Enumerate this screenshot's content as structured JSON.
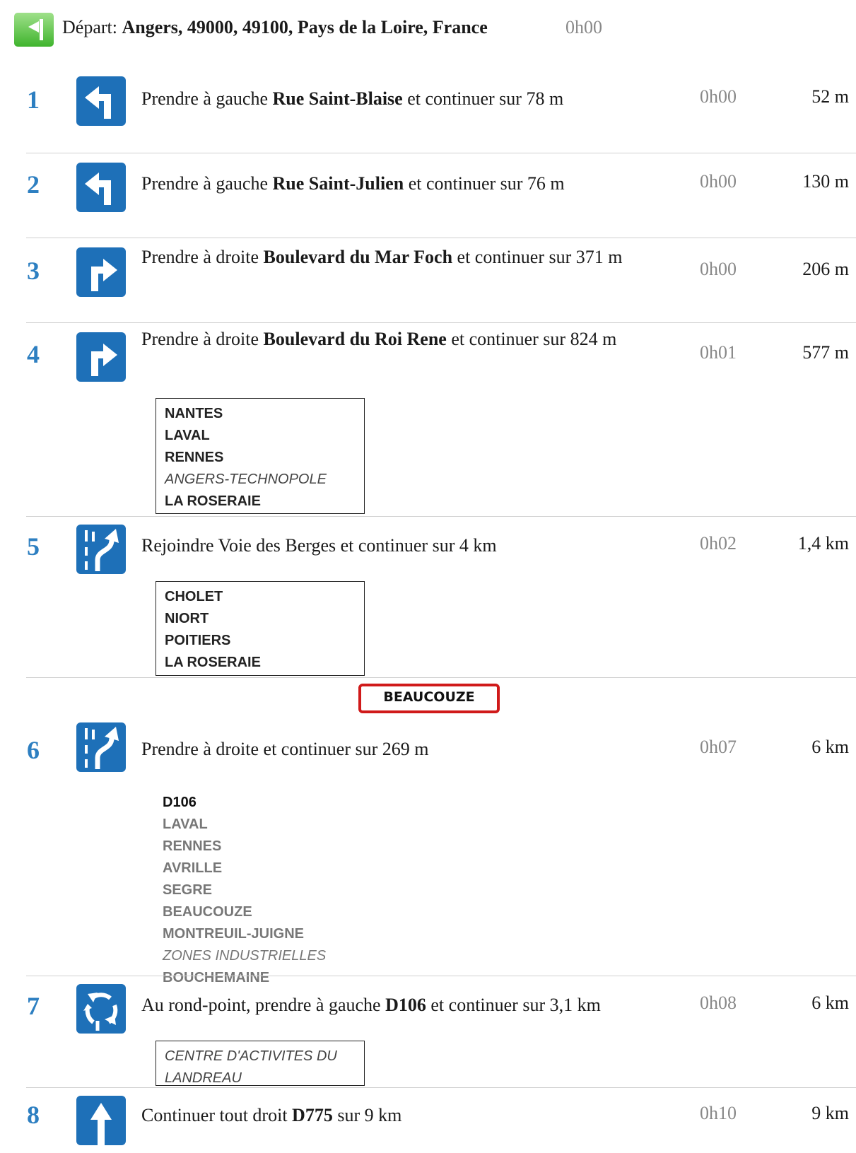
{
  "departure": {
    "prefix": "Départ:",
    "place": "Angers, 49000, 49100, Pays de la Loire, France",
    "time": "0h00",
    "icon": "start-flag-icon"
  },
  "steps": [
    {
      "num": "1",
      "icon": "turn-left-icon",
      "pre": "Prendre à gauche ",
      "road": "Rue Saint-Blaise",
      "post": " et continuer sur 78 m",
      "time": "0h00",
      "dist": "52 m"
    },
    {
      "num": "2",
      "icon": "turn-left-icon",
      "pre": "Prendre à gauche ",
      "road": "Rue Saint-Julien",
      "post": " et continuer sur 76 m",
      "time": "0h00",
      "dist": "130 m"
    },
    {
      "num": "3",
      "icon": "turn-right-icon",
      "pre": "Prendre à droite ",
      "road": "Boulevard du Mar Foch",
      "post": " et continuer sur 371 m",
      "time": "0h00",
      "dist": "206 m"
    },
    {
      "num": "4",
      "icon": "turn-right-icon",
      "pre": "Prendre à droite ",
      "road": "Boulevard du Roi Rene",
      "post": " et continuer sur 824 m",
      "time": "0h01",
      "dist": "577 m",
      "signs": [
        "NANTES",
        "LAVAL",
        "RENNES",
        "ANGERS-TECHNOPOLE",
        "LA ROSERAIE"
      ]
    },
    {
      "num": "5",
      "icon": "merge-right-icon",
      "pre": "Rejoindre Voie des Berges et continuer sur 4 km",
      "road": "",
      "post": "",
      "time": "0h02",
      "dist": "1,4 km",
      "signs": [
        "CHOLET",
        "NIORT",
        "POITIERS",
        "LA ROSERAIE"
      ]
    },
    {
      "num": "6",
      "icon": "merge-right-icon",
      "pre": "Prendre à droite et continuer sur 269 m",
      "road": "",
      "post": "",
      "time": "0h07",
      "dist": "6 km",
      "town_sign": "BEAUCOUZE",
      "signs": [
        "D106",
        "LAVAL",
        "RENNES",
        "AVRILLE",
        "SEGRE",
        "BEAUCOUZE",
        "MONTREUIL-JUIGNE",
        "ZONES INDUSTRIELLES",
        "BOUCHEMAINE"
      ]
    },
    {
      "num": "7",
      "icon": "roundabout-icon",
      "pre": "Au rond-point, prendre à gauche ",
      "road": "D106",
      "post": " et continuer sur 3,1 km",
      "time": "0h08",
      "dist": "6 km",
      "signs": [
        "CENTRE D'ACTIVITES DU LANDREAU"
      ]
    },
    {
      "num": "8",
      "icon": "straight-icon",
      "pre": "Continuer tout droit ",
      "road": "D775",
      "post": " sur 9 km",
      "time": "0h10",
      "dist": "9 km"
    }
  ],
  "colors": {
    "icon_blue": "#1e70b8",
    "number_blue": "#2d7fc1",
    "town_sign_red": "#d01a1a",
    "start_green": "#3fb42d"
  }
}
